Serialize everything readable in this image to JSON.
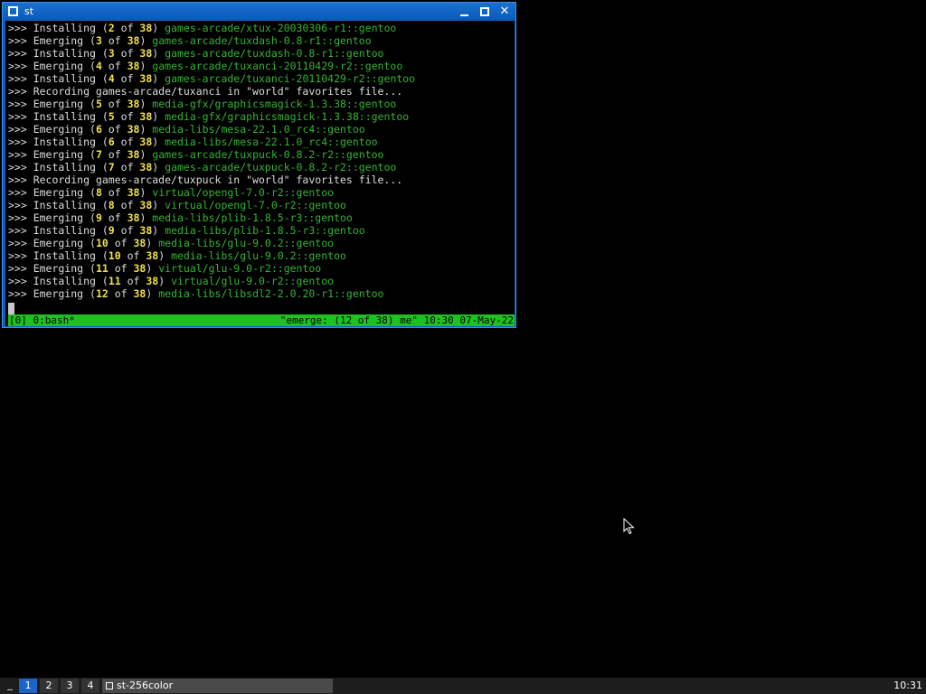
{
  "window": {
    "title": "st",
    "minimize_icon": "minimize-icon",
    "maximize_icon": "maximize-icon",
    "close_icon": "close-icon",
    "close_glyph": "✕"
  },
  "terminal": {
    "lines": [
      {
        "prefix": ">>> Installing (",
        "n": "2",
        "mid": " of ",
        "total": "38",
        "close": ") ",
        "pkg": "games-arcade/xtux-20030306-r1::gentoo"
      },
      {
        "prefix": ">>> Emerging (",
        "n": "3",
        "mid": " of ",
        "total": "38",
        "close": ") ",
        "pkg": "games-arcade/tuxdash-0.8-r1::gentoo"
      },
      {
        "prefix": ">>> Installing (",
        "n": "3",
        "mid": " of ",
        "total": "38",
        "close": ") ",
        "pkg": "games-arcade/tuxdash-0.8-r1::gentoo"
      },
      {
        "prefix": ">>> Emerging (",
        "n": "4",
        "mid": " of ",
        "total": "38",
        "close": ") ",
        "pkg": "games-arcade/tuxanci-20110429-r2::gentoo"
      },
      {
        "prefix": ">>> Installing (",
        "n": "4",
        "mid": " of ",
        "total": "38",
        "close": ") ",
        "pkg": "games-arcade/tuxanci-20110429-r2::gentoo"
      },
      {
        "plain": ">>> Recording games-arcade/tuxanci in \"world\" favorites file..."
      },
      {
        "prefix": ">>> Emerging (",
        "n": "5",
        "mid": " of ",
        "total": "38",
        "close": ") ",
        "pkg": "media-gfx/graphicsmagick-1.3.38::gentoo"
      },
      {
        "prefix": ">>> Installing (",
        "n": "5",
        "mid": " of ",
        "total": "38",
        "close": ") ",
        "pkg": "media-gfx/graphicsmagick-1.3.38::gentoo"
      },
      {
        "prefix": ">>> Emerging (",
        "n": "6",
        "mid": " of ",
        "total": "38",
        "close": ") ",
        "pkg": "media-libs/mesa-22.1.0_rc4::gentoo"
      },
      {
        "prefix": ">>> Installing (",
        "n": "6",
        "mid": " of ",
        "total": "38",
        "close": ") ",
        "pkg": "media-libs/mesa-22.1.0_rc4::gentoo"
      },
      {
        "prefix": ">>> Emerging (",
        "n": "7",
        "mid": " of ",
        "total": "38",
        "close": ") ",
        "pkg": "games-arcade/tuxpuck-0.8.2-r2::gentoo"
      },
      {
        "prefix": ">>> Installing (",
        "n": "7",
        "mid": " of ",
        "total": "38",
        "close": ") ",
        "pkg": "games-arcade/tuxpuck-0.8.2-r2::gentoo"
      },
      {
        "plain": ">>> Recording games-arcade/tuxpuck in \"world\" favorites file..."
      },
      {
        "prefix": ">>> Emerging (",
        "n": "8",
        "mid": " of ",
        "total": "38",
        "close": ") ",
        "pkg": "virtual/opengl-7.0-r2::gentoo"
      },
      {
        "prefix": ">>> Installing (",
        "n": "8",
        "mid": " of ",
        "total": "38",
        "close": ") ",
        "pkg": "virtual/opengl-7.0-r2::gentoo"
      },
      {
        "prefix": ">>> Emerging (",
        "n": "9",
        "mid": " of ",
        "total": "38",
        "close": ") ",
        "pkg": "media-libs/plib-1.8.5-r3::gentoo"
      },
      {
        "prefix": ">>> Installing (",
        "n": "9",
        "mid": " of ",
        "total": "38",
        "close": ") ",
        "pkg": "media-libs/plib-1.8.5-r3::gentoo"
      },
      {
        "prefix": ">>> Emerging (",
        "n": "10",
        "mid": " of ",
        "total": "38",
        "close": ") ",
        "pkg": "media-libs/glu-9.0.2::gentoo"
      },
      {
        "prefix": ">>> Installing (",
        "n": "10",
        "mid": " of ",
        "total": "38",
        "close": ") ",
        "pkg": "media-libs/glu-9.0.2::gentoo"
      },
      {
        "prefix": ">>> Emerging (",
        "n": "11",
        "mid": " of ",
        "total": "38",
        "close": ") ",
        "pkg": "virtual/glu-9.0-r2::gentoo"
      },
      {
        "prefix": ">>> Installing (",
        "n": "11",
        "mid": " of ",
        "total": "38",
        "close": ") ",
        "pkg": "virtual/glu-9.0-r2::gentoo"
      },
      {
        "prefix": ">>> Emerging (",
        "n": "12",
        "mid": " of ",
        "total": "38",
        "close": ") ",
        "pkg": "media-libs/libsdl2-2.0.20-r1::gentoo"
      }
    ]
  },
  "tmux_status": {
    "left": "[0] 0:bash*",
    "right": "\"emerge: (12 of 38) me\" 10:30 07-May-22"
  },
  "taskbar": {
    "menu_glyph": "_",
    "workspaces": [
      {
        "label": "1",
        "active": true
      },
      {
        "label": "2",
        "active": false
      },
      {
        "label": "3",
        "active": false
      },
      {
        "label": "4",
        "active": false
      }
    ],
    "task_label": "st-256color",
    "task_icon": "window-icon",
    "clock": "10:31"
  },
  "colors": {
    "window_border": "#0a5fbf",
    "terminal_bg": "#000000",
    "number": "#f2e14a",
    "package": "#35b335",
    "status_bar": "#1fc11f",
    "active_workspace": "#1b65c9"
  }
}
